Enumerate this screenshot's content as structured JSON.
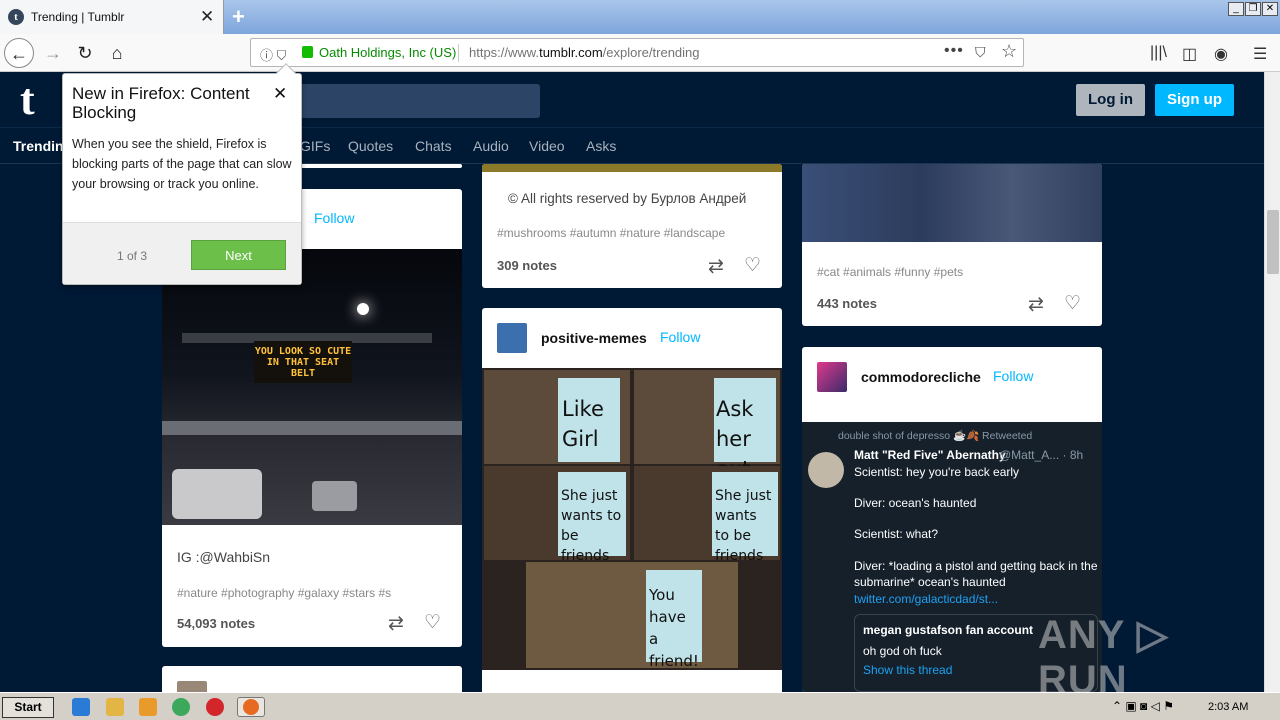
{
  "browser": {
    "tab_title": "Trending | Tumblr",
    "tab_close": "✕",
    "new_tab": "+",
    "org": "Oath Holdings, Inc (US)",
    "url_prefix": "https://www.",
    "url_domain": "tumblr.com",
    "url_path": "/explore/trending",
    "more": "•••"
  },
  "header": {
    "logo": "t",
    "login": "Log in",
    "signup": "Sign up"
  },
  "categories": [
    "Trending",
    "GIFs",
    "Quotes",
    "Chats",
    "Audio",
    "Video",
    "Asks"
  ],
  "popup": {
    "title": "New in Firefox: Content Blocking",
    "close": "✕",
    "body": "When you see the shield, Firefox is blocking parts of the page that can slow your browsing or track you online.",
    "step": "1 of 3",
    "next": "Next"
  },
  "posts": {
    "col1": {
      "follow": "Follow",
      "sign_text": "YOU LOOK SO CUTE IN THAT SEAT BELT",
      "caption": "IG :@WahbiSn",
      "tags": "#nature   #photography   #galaxy   #stars   #s",
      "notes": "54,093 notes"
    },
    "col2_top": {
      "caption": "© All rights reserved  by Бурлов Андрей",
      "tags": "#mushrooms   #autumn   #nature   #landscape",
      "notes": "309 notes"
    },
    "col2_meme": {
      "blog": "positive-memes",
      "follow": "Follow",
      "panels": [
        "Like Girl",
        "Ask her out",
        "She just wants to be friends",
        "She just wants to be friends",
        "You have a friend!"
      ]
    },
    "col3_top": {
      "tags": "#cat   #animals   #funny   #pets",
      "notes": "443 notes"
    },
    "col3_tweet": {
      "blog": "commodorecliche",
      "follow": "Follow",
      "retweeted": "double shot of depresso ☕🍂 Retweeted",
      "author": "Matt \"Red Five\" Abernathy",
      "handle": "@Matt_A... · 8h",
      "lines": [
        "Scientist: hey you're back early",
        "Diver: ocean's haunted",
        "Scientist: what?",
        "Diver: *loading a pistol and getting back in the submarine* ocean's haunted"
      ],
      "link": "twitter.com/galacticdad/st...",
      "quote_author": "megan gustafson fan account",
      "quote_text": "oh god oh fuck",
      "show_thread": "Show this thread"
    }
  },
  "taskbar": {
    "start": "Start",
    "clock": "2:03 AM"
  },
  "watermark": "ANY ▷ RUN"
}
